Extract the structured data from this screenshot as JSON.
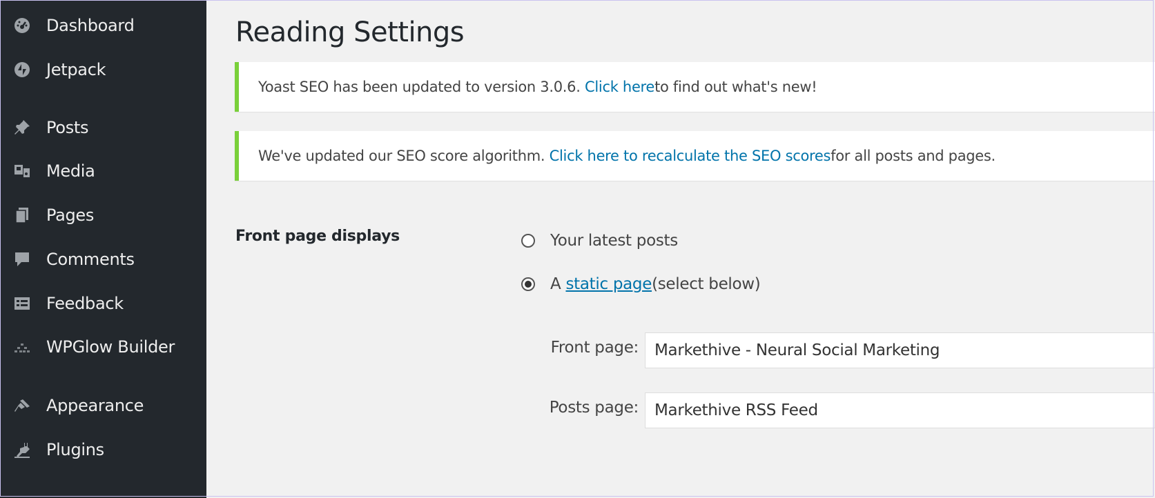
{
  "sidebar": {
    "items": [
      {
        "label": "Dashboard",
        "icon": "dashboard-icon"
      },
      {
        "label": "Jetpack",
        "icon": "jetpack-icon"
      },
      {
        "label": "Posts",
        "icon": "pushpin-icon"
      },
      {
        "label": "Media",
        "icon": "media-icon"
      },
      {
        "label": "Pages",
        "icon": "pages-icon"
      },
      {
        "label": "Comments",
        "icon": "comment-icon"
      },
      {
        "label": "Feedback",
        "icon": "feedback-icon"
      },
      {
        "label": "WPGlow Builder",
        "icon": "builder-icon"
      },
      {
        "label": "Appearance",
        "icon": "paintbrush-icon"
      },
      {
        "label": "Plugins",
        "icon": "plugin-icon"
      }
    ]
  },
  "main": {
    "title": "Reading Settings",
    "notices": [
      {
        "before": "Yoast SEO has been updated to version 3.0.6. ",
        "link": "Click here",
        "after": " to find out what's new!"
      },
      {
        "before": "We've updated our SEO score algorithm. ",
        "link": "Click here to recalculate the SEO scores",
        "after": " for all posts and pages."
      }
    ],
    "front_page_displays": {
      "label": "Front page displays",
      "option_latest": "Your latest posts",
      "option_static_prefix": "A ",
      "option_static_link": "static page",
      "option_static_suffix": " (select below)",
      "selected": "static"
    },
    "front_page": {
      "label": "Front page:",
      "value": "Markethive - Neural Social Marketing"
    },
    "posts_page": {
      "label": "Posts page:",
      "value": "Markethive RSS Feed"
    }
  },
  "colors": {
    "sidebar_bg": "#23282d",
    "notice_border": "#7ad03a",
    "link": "#0073aa"
  }
}
